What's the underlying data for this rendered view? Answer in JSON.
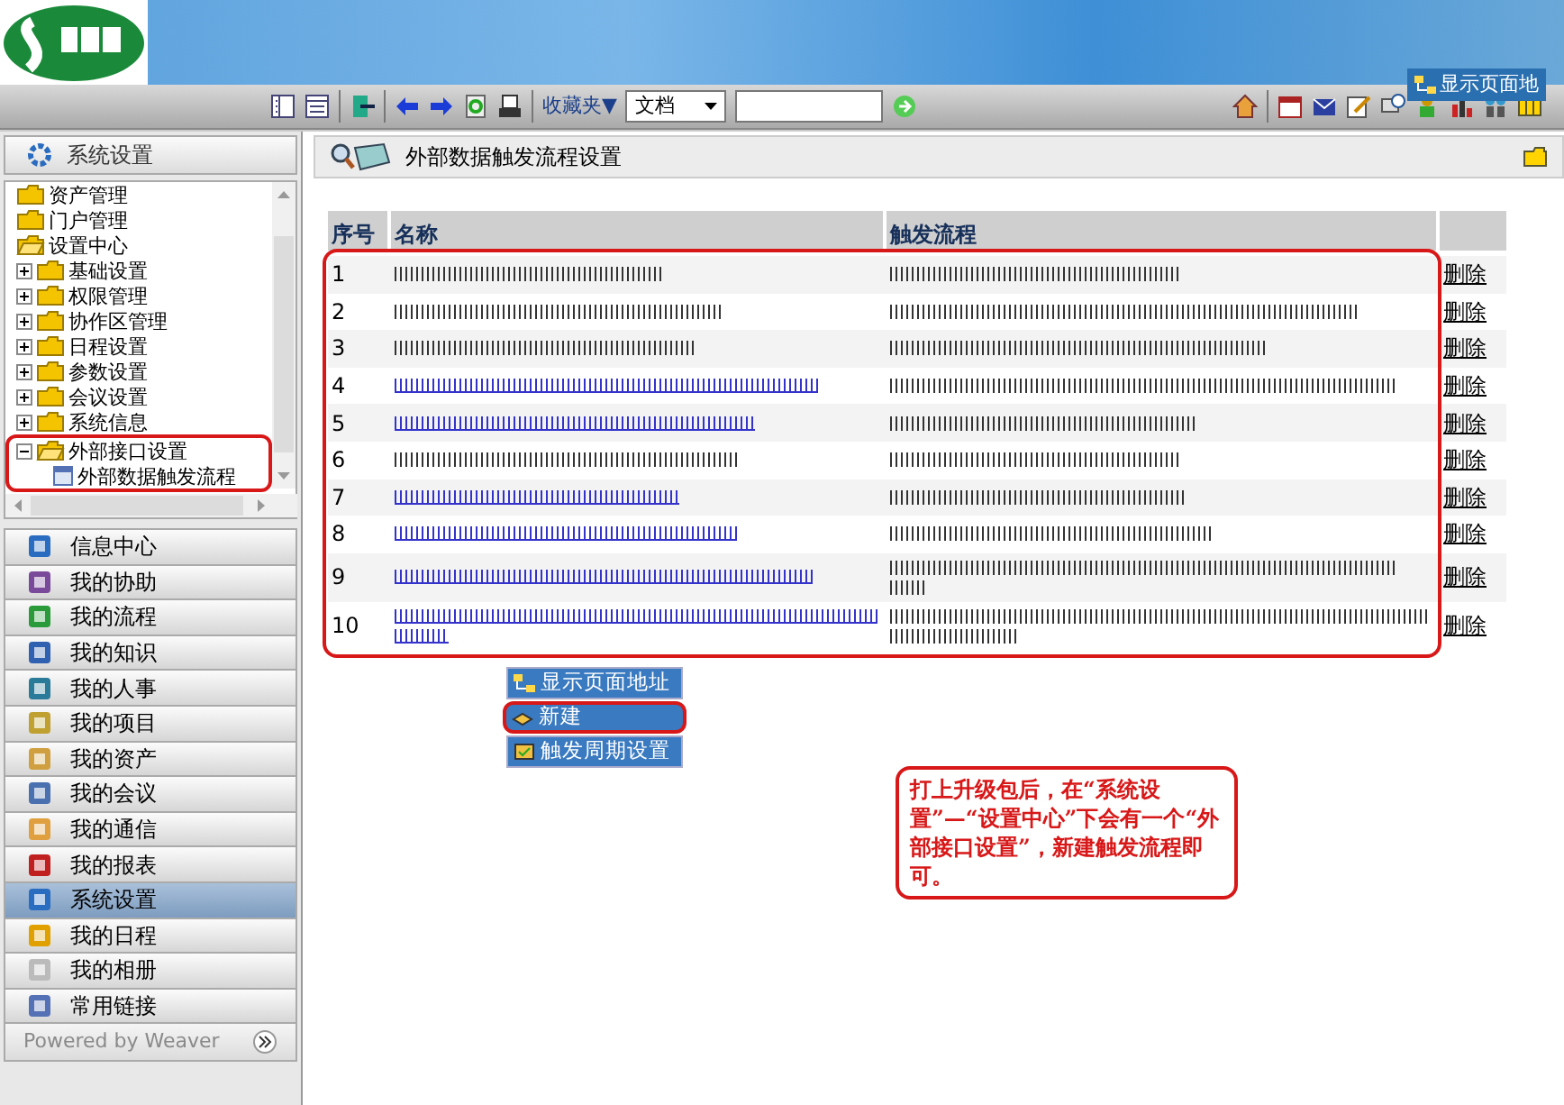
{
  "popup_button": {
    "label": "显示页面地"
  },
  "toolbar": {
    "favorites": "收藏夹▼",
    "doc_select": "文档"
  },
  "sidebar": {
    "header": "系统设置",
    "tree": [
      {
        "label": "资产管理",
        "expanded": false,
        "highlighted": false
      },
      {
        "label": "门户管理",
        "expanded": false,
        "highlighted": false
      },
      {
        "label": "设置中心",
        "expanded": true,
        "highlighted": false,
        "children": [
          {
            "label": "基础设置",
            "expanded": false,
            "highlighted": false
          },
          {
            "label": "权限管理",
            "expanded": false,
            "highlighted": false
          },
          {
            "label": "协作区管理",
            "expanded": false,
            "highlighted": false
          },
          {
            "label": "日程设置",
            "expanded": false,
            "highlighted": false
          },
          {
            "label": "参数设置",
            "expanded": false,
            "highlighted": false
          },
          {
            "label": "会议设置",
            "expanded": false,
            "highlighted": false
          },
          {
            "label": "系统信息",
            "expanded": false,
            "highlighted": false
          },
          {
            "label": "外部接口设置",
            "expanded": true,
            "highlighted": true,
            "children": [
              {
                "label": "外部数据触发流程",
                "kind": "page"
              }
            ]
          }
        ]
      }
    ],
    "menu": [
      {
        "label": "信息中心",
        "selected": false
      },
      {
        "label": "我的协助",
        "selected": false
      },
      {
        "label": "我的流程",
        "selected": false
      },
      {
        "label": "我的知识",
        "selected": false
      },
      {
        "label": "我的人事",
        "selected": false
      },
      {
        "label": "我的项目",
        "selected": false
      },
      {
        "label": "我的资产",
        "selected": false
      },
      {
        "label": "我的会议",
        "selected": false
      },
      {
        "label": "我的通信",
        "selected": false
      },
      {
        "label": "我的报表",
        "selected": false
      },
      {
        "label": "系统设置",
        "selected": true
      },
      {
        "label": "我的日程",
        "selected": false
      },
      {
        "label": "我的相册",
        "selected": false
      },
      {
        "label": "常用链接",
        "selected": false
      }
    ],
    "footer": "Powered by Weaver"
  },
  "content": {
    "title": "外部数据触发流程设置",
    "table": {
      "columns": [
        "序号",
        "名称",
        "触发流程"
      ],
      "rows_highlighted": true,
      "rows": [
        {
          "index": "1",
          "kind": "text",
          "action": "删除"
        },
        {
          "index": "2",
          "kind": "text",
          "action": "删除"
        },
        {
          "index": "3",
          "kind": "text",
          "action": "删除"
        },
        {
          "index": "4",
          "kind": "link",
          "action": "删除"
        },
        {
          "index": "5",
          "kind": "link",
          "action": "删除"
        },
        {
          "index": "6",
          "kind": "text",
          "action": "删除"
        },
        {
          "index": "7",
          "kind": "link",
          "action": "删除"
        },
        {
          "index": "8",
          "kind": "link",
          "action": "删除"
        },
        {
          "index": "9",
          "kind": "link",
          "action": "删除"
        },
        {
          "index": "10",
          "kind": "link",
          "action": "删除"
        }
      ]
    },
    "buttons": [
      {
        "label": "显示页面地址",
        "highlighted": false
      },
      {
        "label": "新建",
        "highlighted": true
      },
      {
        "label": "触发周期设置",
        "highlighted": false
      }
    ],
    "note": "打上升级包后，在“系统设置”—“设置中心”下会有一个“外部接口设置”，新建触发流程即可。"
  }
}
